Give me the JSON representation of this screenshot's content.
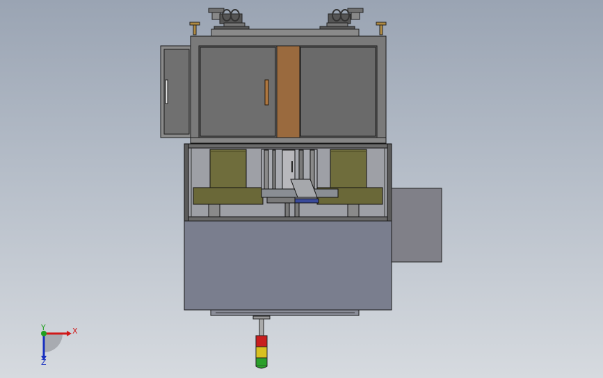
{
  "viewport": {
    "background_top": "#9aa4b3",
    "background_bottom": "#d6dadf"
  },
  "axis_triad": {
    "x_label": "X",
    "y_label": "Y",
    "z_label": "Z",
    "x_color": "#d01818",
    "y_color": "#20a020",
    "z_color": "#1830c0"
  },
  "stack_light": {
    "colors": [
      "#c81e1e",
      "#d8c020",
      "#2aa02a"
    ]
  },
  "colors": {
    "cabinet_face": "#6c6c6c",
    "cabinet_frame": "#7a7a7a",
    "wood_panel": "#9a6a3e",
    "base_cabinet": "#7a7e8e",
    "olive_parts": "#6f6d3c",
    "side_panel": "#808088"
  }
}
